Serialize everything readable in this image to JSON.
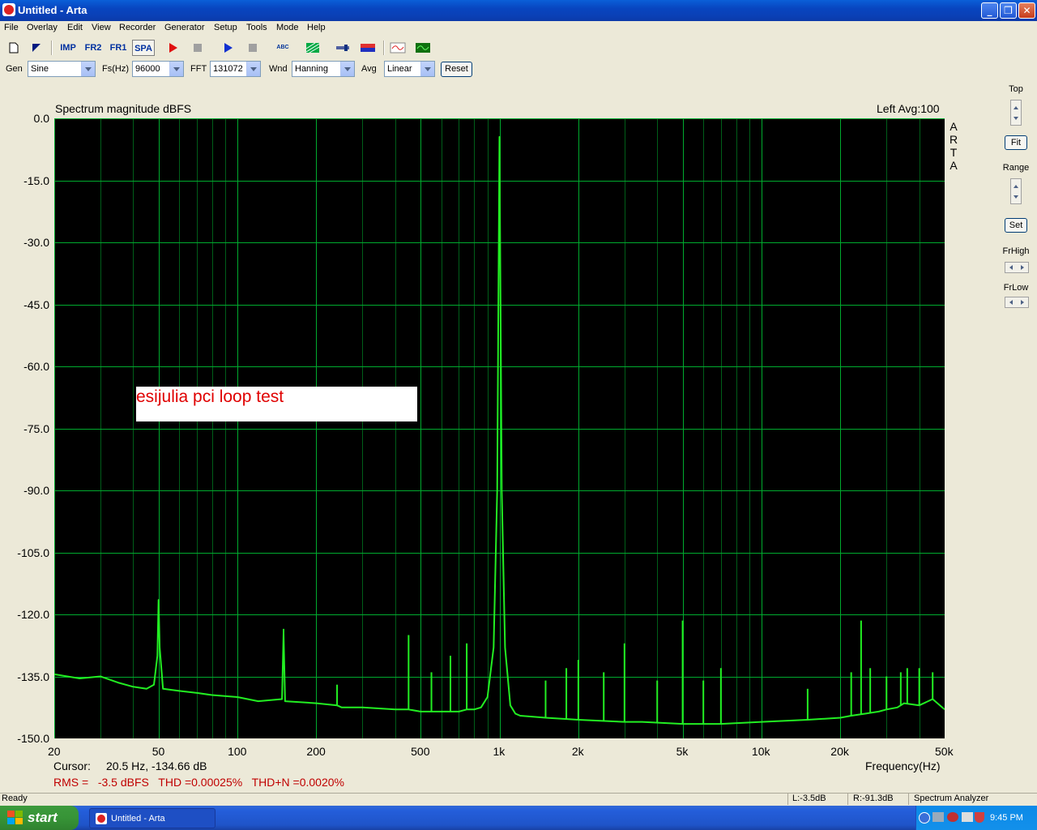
{
  "window": {
    "title": "Untitled - Arta",
    "min_label": "_",
    "max_label": "❒",
    "close_label": "✕"
  },
  "menu": [
    "File",
    "Overlay",
    "Edit",
    "View",
    "Recorder",
    "Generator",
    "Setup",
    "Tools",
    "Mode",
    "Help"
  ],
  "toolbar": {
    "imp_label": "IMP",
    "fr2_label": "FR2",
    "fr1_label": "FR1",
    "spa_label": "SPA",
    "abc_label": "ABC"
  },
  "controls": {
    "gen_label": "Gen",
    "gen_value": "Sine",
    "fs_label": "Fs(Hz)",
    "fs_value": "96000",
    "fft_label": "FFT",
    "fft_value": "131072",
    "wnd_label": "Wnd",
    "wnd_value": "Hanning",
    "avg_label": "Avg",
    "avg_value": "Linear",
    "reset_label": "Reset"
  },
  "graph": {
    "title": "Spectrum magnitude dBFS",
    "channel_info": "Left  Avg:100",
    "logo": [
      "A",
      "R",
      "T",
      "A"
    ],
    "annotation": "esijulia pci loop test",
    "cursor_label": "Cursor:",
    "cursor_value": "20.5 Hz, -134.66 dB",
    "measurements": "RMS =   -3.5 dBFS   THD =0.00025%   THD+N =0.0020%",
    "trace_color": "#22ee22",
    "grid_color": "#00ab2e",
    "annotation_color": "#e00000"
  },
  "chart_data": {
    "type": "line",
    "title": "Spectrum magnitude dBFS",
    "xlabel": "Frequency(Hz)",
    "ylabel": "",
    "xscale": "log",
    "xlim": [
      20,
      50000
    ],
    "ylim": [
      -150,
      0
    ],
    "ytick_labels": [
      "0.0",
      "-15.0",
      "-30.0",
      "-45.0",
      "-60.0",
      "-75.0",
      "-90.0",
      "-105.0",
      "-120.0",
      "-135.0",
      "-150.0"
    ],
    "yticks": [
      0,
      -15,
      -30,
      -45,
      -60,
      -75,
      -90,
      -105,
      -120,
      -135,
      -150
    ],
    "xtick_labels": [
      "20",
      "50",
      "100",
      "200",
      "500",
      "1k",
      "2k",
      "5k",
      "10k",
      "20k",
      "50k"
    ],
    "xticks": [
      20,
      50,
      100,
      200,
      500,
      1000,
      2000,
      5000,
      10000,
      20000,
      50000
    ],
    "grid": true,
    "series": [
      {
        "x": [
          20,
          25,
          30,
          35,
          40,
          45,
          48,
          49.5,
          50,
          50.5,
          52,
          60,
          70,
          80,
          100,
          120,
          148,
          150,
          152,
          200,
          240,
          250,
          300,
          400,
          450,
          500,
          600,
          700,
          750,
          800,
          850,
          900,
          950,
          980,
          1000,
          1020,
          1050,
          1100,
          1150,
          1200,
          1500,
          2000,
          3000,
          3500,
          5000,
          7000,
          10000,
          15000,
          20000,
          22000,
          25000,
          28000,
          30000,
          33000,
          35000,
          40000,
          45000,
          50000
        ],
        "y": [
          -134.5,
          -135.5,
          -135,
          -136.5,
          -137.5,
          -138,
          -137,
          -130,
          -116.5,
          -128,
          -138,
          -138.5,
          -139,
          -139.5,
          -140,
          -141,
          -140.5,
          -124.5,
          -141,
          -141.5,
          -142,
          -142.5,
          -142.5,
          -143,
          -143,
          -143.5,
          -143.5,
          -143.5,
          -143,
          -143,
          -142.5,
          -140,
          -128,
          -90,
          -4.5,
          -90,
          -128,
          -142,
          -144,
          -144.5,
          -145,
          -145.5,
          -146,
          -146,
          -146.5,
          -146.5,
          -146,
          -145.5,
          -145,
          -144.5,
          -144,
          -143.5,
          -143,
          -142.5,
          -141.5,
          -142,
          -140.5,
          -143
        ]
      }
    ],
    "spurs": [
      {
        "x": 150,
        "y": -123.5
      },
      {
        "x": 240,
        "y": -137
      },
      {
        "x": 450,
        "y": -125
      },
      {
        "x": 550,
        "y": -134
      },
      {
        "x": 650,
        "y": -130
      },
      {
        "x": 750,
        "y": -127
      },
      {
        "x": 1500,
        "y": -136
      },
      {
        "x": 1800,
        "y": -133
      },
      {
        "x": 2000,
        "y": -131
      },
      {
        "x": 2500,
        "y": -134
      },
      {
        "x": 3000,
        "y": -127
      },
      {
        "x": 4000,
        "y": -136
      },
      {
        "x": 5000,
        "y": -121.5
      },
      {
        "x": 6000,
        "y": -136
      },
      {
        "x": 7000,
        "y": -133
      },
      {
        "x": 15000,
        "y": -138
      },
      {
        "x": 22000,
        "y": -134
      },
      {
        "x": 24000,
        "y": -121.5
      },
      {
        "x": 26000,
        "y": -133
      },
      {
        "x": 30000,
        "y": -135
      },
      {
        "x": 34000,
        "y": -134
      },
      {
        "x": 36000,
        "y": -133
      },
      {
        "x": 40000,
        "y": -133
      },
      {
        "x": 45000,
        "y": -134
      }
    ]
  },
  "right_panel": {
    "top_label": "Top",
    "fit_label": "Fit",
    "range_label": "Range",
    "set_label": "Set",
    "frhigh_label": "FrHigh",
    "frlow_label": "FrLow"
  },
  "status": {
    "ready": "Ready",
    "left_level": "L:-3.5dB",
    "right_level": "R:-91.3dB",
    "mode": "Spectrum Analyzer"
  },
  "taskbar": {
    "start_label": "start",
    "task_label": "Untitled - Arta",
    "clock": "9:45 PM"
  }
}
